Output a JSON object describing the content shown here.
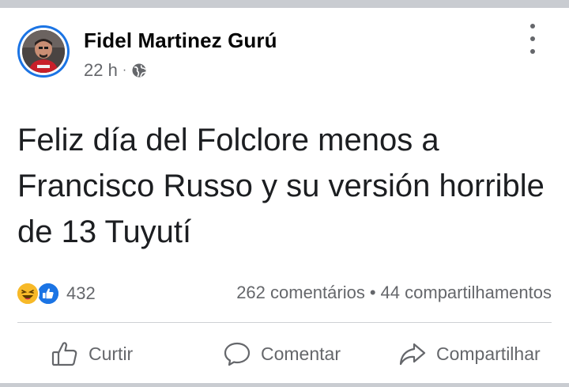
{
  "post": {
    "author": "Fidel Martinez Gurú",
    "time": "22 h",
    "separator": "·",
    "privacy_icon": "globe-icon",
    "text": "Feliz día del Folclore menos a Francisco Russo y su versión horrible de 13 Tuyutí"
  },
  "reactions": {
    "icons": [
      "haha-icon",
      "like-icon"
    ],
    "count": "432"
  },
  "stats": {
    "comments": "262 comentários",
    "dot": "•",
    "shares": "44 compartilhamentos"
  },
  "actions": {
    "like_label": "Curtir",
    "comment_label": "Comentar",
    "share_label": "Compartilhar"
  },
  "colors": {
    "accent": "#1b74e4",
    "text": "#050505",
    "secondary": "#65676b",
    "haha": "#f7b928"
  }
}
